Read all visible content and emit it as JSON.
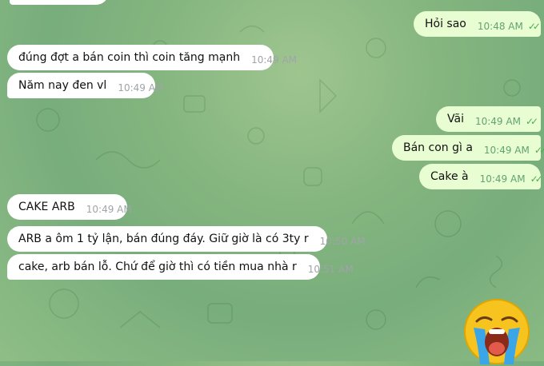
{
  "messages": [
    {
      "text": "Hỏi sao",
      "time": "10:48 AM",
      "dir": "out"
    },
    {
      "text": "đúng đợt a bán coin thì coin tăng mạnh",
      "time": "10:49 AM",
      "dir": "in"
    },
    {
      "text": "Năm nay đen vl",
      "time": "10:49 AM",
      "dir": "in"
    },
    {
      "text": "Vãi",
      "time": "10:49 AM",
      "dir": "out"
    },
    {
      "text": "Bán con gì a",
      "time": "10:49 AM",
      "dir": "out"
    },
    {
      "text": "Cake à",
      "time": "10:49 AM",
      "dir": "out"
    },
    {
      "text": "CAKE ARB",
      "time": "10:49 AM",
      "dir": "in"
    },
    {
      "text": "ARB a ôm 1 tỷ lận, bán đúng đáy. Giữ giờ là có 3ty r",
      "time": "10:50 AM",
      "dir": "in"
    },
    {
      "text": "cake, arb bán lỗ. Chứ để giờ thì có tiền mua nhà r",
      "time": "10:51 AM",
      "dir": "in"
    }
  ],
  "read_status_icon": "double-check-icon",
  "sticker": "crying-emoji-sticker",
  "colors": {
    "incoming": "#ffffff",
    "outgoing": "#e9fdd3",
    "ticks": "#4fae4e"
  }
}
